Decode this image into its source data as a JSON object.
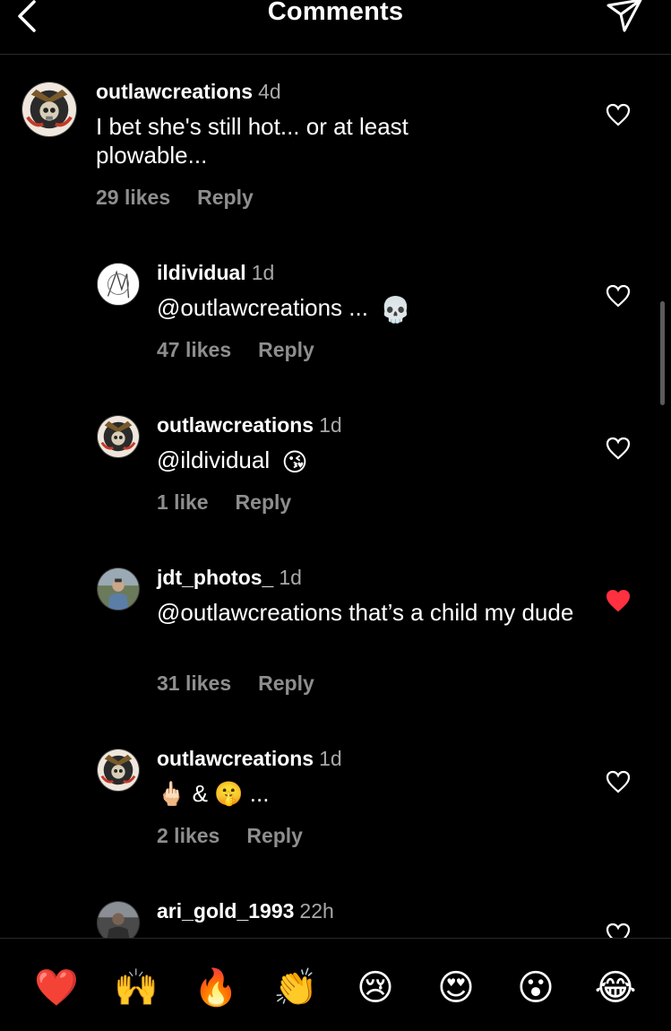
{
  "header": {
    "title": "Comments",
    "back_icon": "chevron-left-icon",
    "send_icon": "paper-plane-icon"
  },
  "comments": [
    {
      "username": "outlawcreations",
      "time": "4d",
      "text": "I bet she's still hot... or at least plowable...",
      "likes": "29 likes",
      "reply_label": "Reply",
      "liked": false
    },
    {
      "username": "ildividual",
      "time": "1d",
      "mention": "@outlawcreations",
      "text": " ... ",
      "emoji": "💀",
      "likes": "47 likes",
      "reply_label": "Reply",
      "liked": false
    },
    {
      "username": "outlawcreations",
      "time": "1d",
      "mention": "@ildividual",
      "text": " ",
      "emoji": "😘",
      "likes": "1 like",
      "reply_label": "Reply",
      "liked": false
    },
    {
      "username": "jdt_photos_",
      "time": "1d",
      "mention": "@outlawcreations",
      "text": " that’s a child my dude",
      "likes": "31 likes",
      "reply_label": "Reply",
      "liked": true
    },
    {
      "username": "outlawcreations",
      "time": "1d",
      "text": "🖕🏻 & 🤫 ...",
      "likes": "2 likes",
      "reply_label": "Reply",
      "liked": false
    },
    {
      "username": "ari_gold_1993",
      "time": "22h",
      "liked": false
    }
  ],
  "reactions": [
    "❤️",
    "🙌",
    "🔥",
    "👏",
    "😢",
    "😍",
    "😮",
    "😂"
  ],
  "colors": {
    "background": "#000000",
    "text": "#ffffff",
    "muted": "#8e8e8e",
    "liked_heart": "#ff3040"
  }
}
